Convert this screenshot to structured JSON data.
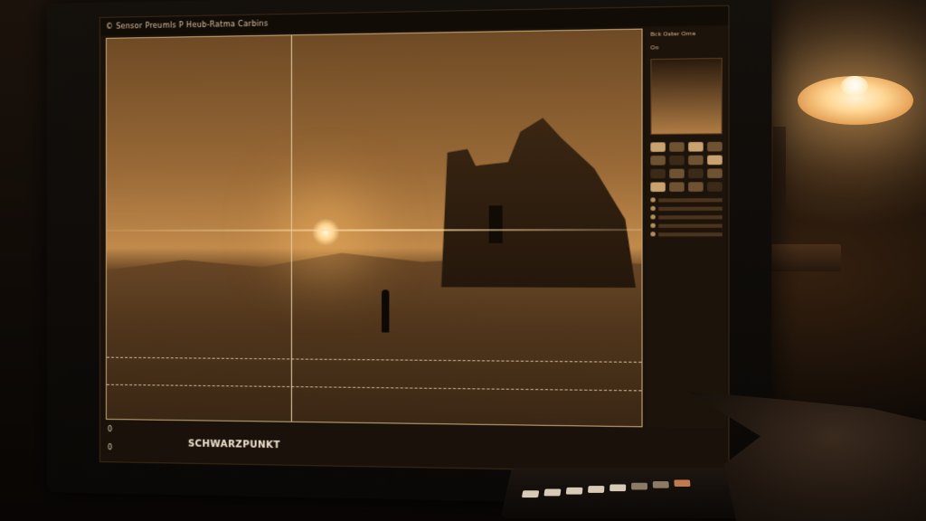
{
  "app": {
    "title": "© Sensor Preumls P Heub-Ratma Carbins",
    "brand": "SCHWARZPUNKT",
    "status_left_top": "0",
    "status_left_bottom": "0"
  },
  "panel": {
    "header": "Bck Oster Ome",
    "subheader": "Oo"
  },
  "icons": {
    "lamp": "desk-lamp-icon"
  }
}
